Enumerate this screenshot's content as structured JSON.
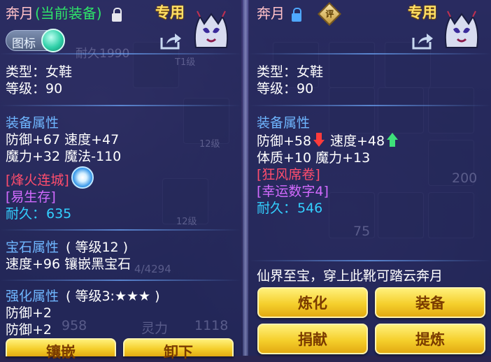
{
  "left": {
    "name": "奔月",
    "equipped_tag": "(当前装备)",
    "exclusive": "专用",
    "icon_toggle_label": "图标",
    "type_line": "类型：女鞋",
    "level_line": "等级：90",
    "equip_attr_title": "装备属性",
    "attr_line1": "防御+67 速度+47",
    "attr_line2": "魔力+32 魔法-110",
    "special1": "[烽火连城]",
    "special2": "[易生存]",
    "durability_label": "耐久：",
    "durability_value": "635",
    "gem_title": "宝石属性",
    "gem_level": "( 等级12 )",
    "gem_line": "速度+96 镶嵌黑宝石",
    "enhance_title": "强化属性",
    "enhance_level": "( 等级3:★★★ )",
    "enhance_line1": "防御+2",
    "enhance_line2": "防御+2",
    "button_inlay": "镶嵌",
    "button_unequip": "卸下"
  },
  "right": {
    "name": "奔月",
    "rate_badge": "评",
    "exclusive": "专用",
    "type_line": "类型：女鞋",
    "level_line": "等级：90",
    "equip_attr_title": "装备属性",
    "attr_def": "防御+58",
    "attr_spd": "速度+48",
    "attr_line2": "体质+10 魔力+13",
    "special1": "[狂风席卷]",
    "special2": "[幸运数字4]",
    "durability_label": "耐久：",
    "durability_value": "546",
    "description": "仙界至宝，穿上此靴可踏云奔月",
    "button_refine": "炼化",
    "button_equip": "装备",
    "button_donate": "捐献",
    "button_extract": "提炼"
  },
  "background": {
    "durability_hint": "耐久1990",
    "level_tag1": "T1级",
    "level_tag2": "12级",
    "level_tag3": "12级",
    "hp_fraction": "4/4294",
    "stat1": "958",
    "stat2_label": "灵力",
    "stat2_value": "1118",
    "count1": "200",
    "count2": "75"
  },
  "colors": {
    "name": "#ffc1c8",
    "equipped": "#2ee56a",
    "section": "#6fb6ff",
    "value": "#33d0ff",
    "special_red": "#ff4d6d",
    "special_purple": "#d36bff",
    "button": "#f5cf2c",
    "button_text": "#7a3b00"
  },
  "icons": {
    "lock_open": "unlock-icon",
    "lock_closed": "lock-icon",
    "share": "share-icon",
    "avatar": "mask-avatar-icon",
    "down_arrow": "arrow-down-icon",
    "up_arrow": "arrow-up-icon",
    "swirl": "swirl-icon"
  }
}
